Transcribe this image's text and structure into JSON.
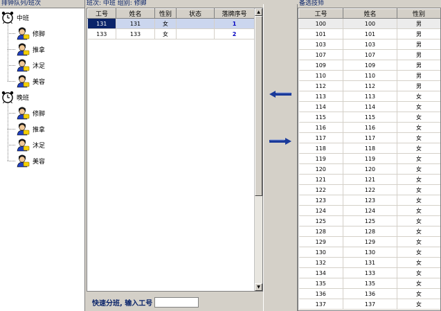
{
  "left_panel": {
    "caption": "排钟队列/班次",
    "groups": [
      {
        "label": "中班",
        "items": [
          "修脚",
          "推拿",
          "沐足",
          "美容"
        ]
      },
      {
        "label": "晚班",
        "items": [
          "修脚",
          "推拿",
          "沐足",
          "美容"
        ]
      }
    ]
  },
  "middle_panel": {
    "caption": "班次: 中班   组别: 修脚",
    "columns": [
      "工号",
      "姓名",
      "性别",
      "状态",
      "落牌序号"
    ],
    "rows": [
      {
        "id": "131",
        "name": "131",
        "gender": "女",
        "status": "",
        "seq": "1"
      },
      {
        "id": "133",
        "name": "133",
        "gender": "女",
        "status": "",
        "seq": "2"
      }
    ],
    "quick_label": "快速分班, 输入工号",
    "quick_value": ""
  },
  "right_panel": {
    "caption": "备选技师",
    "columns": [
      "工号",
      "姓名",
      "性别"
    ],
    "rows": [
      {
        "id": "100",
        "name": "100",
        "gender": "男"
      },
      {
        "id": "101",
        "name": "101",
        "gender": "男"
      },
      {
        "id": "103",
        "name": "103",
        "gender": "男"
      },
      {
        "id": "107",
        "name": "107",
        "gender": "男"
      },
      {
        "id": "109",
        "name": "109",
        "gender": "男"
      },
      {
        "id": "110",
        "name": "110",
        "gender": "男"
      },
      {
        "id": "112",
        "name": "112",
        "gender": "男"
      },
      {
        "id": "113",
        "name": "113",
        "gender": "女"
      },
      {
        "id": "114",
        "name": "114",
        "gender": "女"
      },
      {
        "id": "115",
        "name": "115",
        "gender": "女"
      },
      {
        "id": "116",
        "name": "116",
        "gender": "女"
      },
      {
        "id": "117",
        "name": "117",
        "gender": "女"
      },
      {
        "id": "118",
        "name": "118",
        "gender": "女"
      },
      {
        "id": "119",
        "name": "119",
        "gender": "女"
      },
      {
        "id": "120",
        "name": "120",
        "gender": "女"
      },
      {
        "id": "121",
        "name": "121",
        "gender": "女"
      },
      {
        "id": "122",
        "name": "122",
        "gender": "女"
      },
      {
        "id": "123",
        "name": "123",
        "gender": "女"
      },
      {
        "id": "124",
        "name": "124",
        "gender": "女"
      },
      {
        "id": "125",
        "name": "125",
        "gender": "女"
      },
      {
        "id": "128",
        "name": "128",
        "gender": "女"
      },
      {
        "id": "129",
        "name": "129",
        "gender": "女"
      },
      {
        "id": "130",
        "name": "130",
        "gender": "女"
      },
      {
        "id": "132",
        "name": "131",
        "gender": "女"
      },
      {
        "id": "134",
        "name": "133",
        "gender": "女"
      },
      {
        "id": "135",
        "name": "135",
        "gender": "女"
      },
      {
        "id": "136",
        "name": "136",
        "gender": "女"
      },
      {
        "id": "137",
        "name": "137",
        "gender": "女"
      }
    ]
  },
  "icons": {
    "clock": "alarm-clock-icon",
    "person": "technician-icon",
    "left_arrow": "arrow-left-icon",
    "right_arrow": "arrow-right-icon"
  },
  "colors": {
    "caption": "#0a246a",
    "selection": "#0a246a",
    "seq_number": "#0000c0",
    "arrow": "#1a3a9a"
  }
}
